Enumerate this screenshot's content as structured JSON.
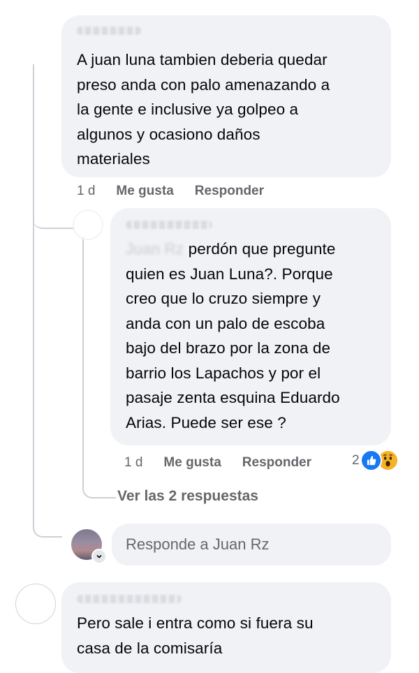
{
  "comment1": {
    "text": "A juan luna tambien deberia quedar\npreso anda con palo amenazando a\nla gente e inclusive ya golpeo a\nalgunos y ocasiono daños\nmateriales",
    "time": "1 d",
    "like_label": "Me gusta",
    "reply_label": "Responder"
  },
  "reply1": {
    "text_prefix": "Juan Rz",
    "text": " perdón que pregunte\nquien es Juan Luna?. Porque\ncreo que lo cruzo siempre y\nanda con un palo de escoba\nbajo del brazo por la zona de\nbarrio los Lapachos y por el\npasaje zenta esquina Eduardo\nArias. Puede ser ese ?",
    "time": "1 d",
    "like_label": "Me gusta",
    "reply_label": "Responder",
    "reaction_count": "2",
    "reaction_icons": [
      "like-icon",
      "wow-icon"
    ]
  },
  "view_replies_label": "Ver las 2 respuestas",
  "reply_box": {
    "placeholder": "Responde a Juan Rz"
  },
  "comment2": {
    "text": "Pero sale i entra como si fuera su\ncasa de la comisaría"
  },
  "colors": {
    "bubble": "#f0f2f5",
    "meta": "#65676b",
    "like_blue": "#1877f2",
    "wow_yellow": "#f7b125"
  }
}
